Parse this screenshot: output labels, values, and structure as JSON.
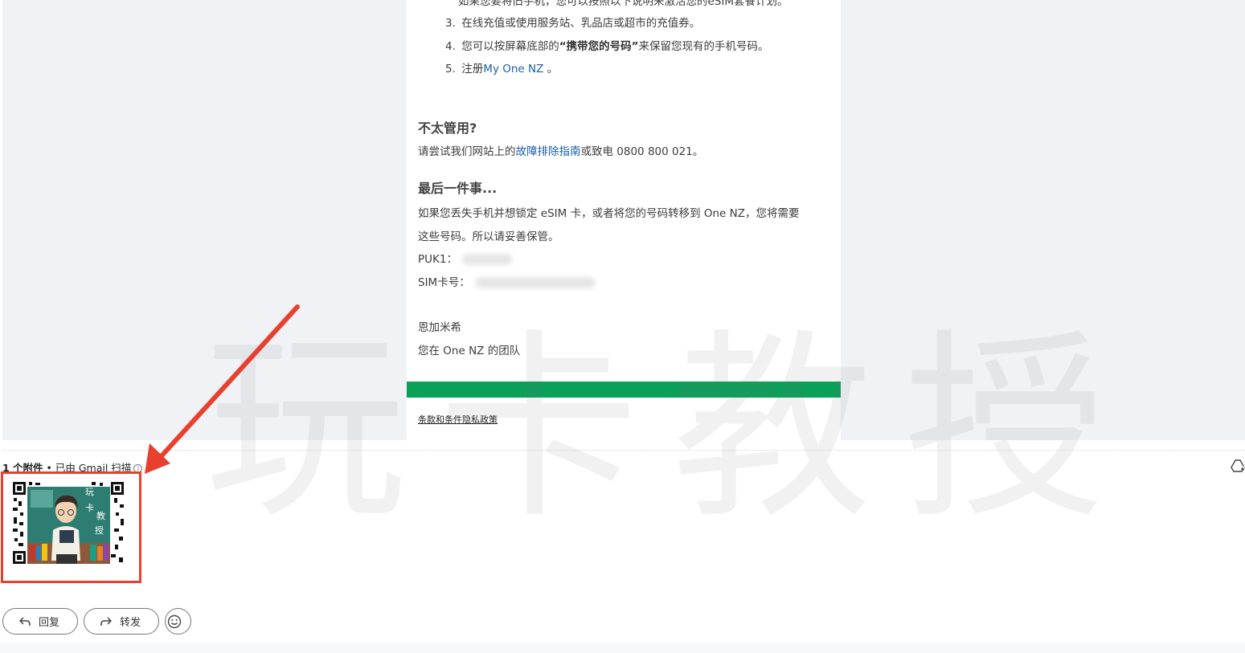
{
  "email": {
    "cut_line": "如果您要将旧手机，您可以按照以下说明来激活您的eSIM套餐计划。",
    "steps": [
      {
        "num": "3.",
        "text": "在线充值或使用服务站、乳品店或超市的充值券。"
      },
      {
        "num": "4.",
        "pre": "您可以按屏幕底部的",
        "bold": "“携带您的号码”",
        "post": "来保留您现有的手机号码。"
      },
      {
        "num": "5.",
        "pre": "注册",
        "link": "My One NZ",
        "post": " 。"
      }
    ],
    "help_heading": "不太管用?",
    "help_pre": "请尝试我们网站上的",
    "help_link": "故障排除指南",
    "help_post": "或致电 0800 800 021。",
    "last_heading": "最后一件事...",
    "last_line1": "如果您丢失手机并想锁定 eSIM 卡，或者将您的号码转移到 One NZ，您将需要",
    "last_line2": "这些号码。所以请妥善保管。",
    "puk_label": "PUK1：",
    "sim_label": "SIM卡号：",
    "signoff1": "恩加米希",
    "signoff2": "您在 One NZ 的团队",
    "legal_link": "条款和条件隐私政策"
  },
  "watermark": "玩卡教授",
  "attachments": {
    "count_label": "1 个附件",
    "separator": " • ",
    "scan_label": "已由 Gmail 扫描",
    "info_glyph": "i",
    "thumb_chars": [
      "玩",
      "卡",
      "教",
      "授"
    ]
  },
  "actions": {
    "reply": "回复",
    "forward": "转发"
  },
  "colors": {
    "accent_green": "#0aa058",
    "highlight_red": "#e8402f",
    "link_blue": "#1a5ea8"
  }
}
